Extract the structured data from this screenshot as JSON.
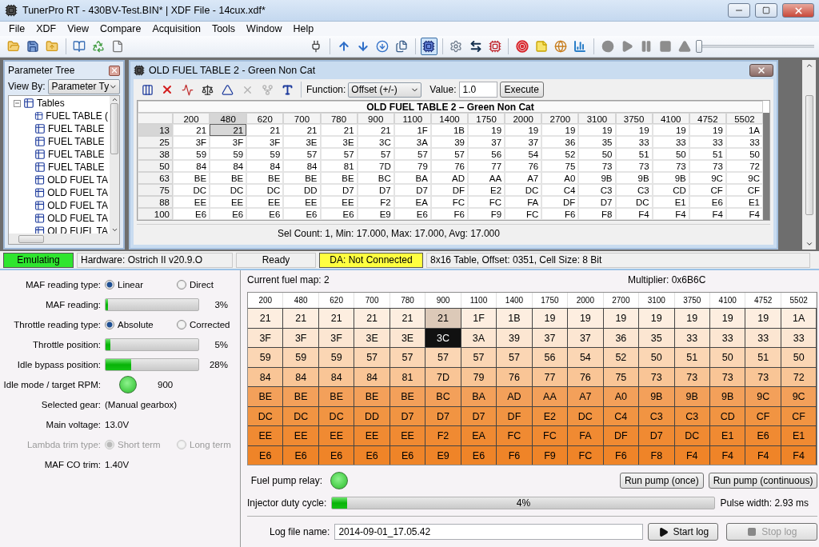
{
  "window": {
    "title": "TunerPro RT - 430BV-Test.BIN* | XDF File - 14cux.xdf*"
  },
  "menu": [
    "File",
    "XDF",
    "View",
    "Compare",
    "Acquisition",
    "Tools",
    "Window",
    "Help"
  ],
  "toolbar": {
    "record_button_disabled": true,
    "position_slider": {
      "level": 0.0
    }
  },
  "parameter_tree": {
    "title": "Parameter Tree",
    "view_by_label": "View By:",
    "view_by_value": "Parameter Ty",
    "items": [
      {
        "label": "Tables",
        "expanded": true,
        "children": [
          {
            "label": "FUEL TABLE ("
          },
          {
            "label": "FUEL TABLE"
          },
          {
            "label": "FUEL TABLE"
          },
          {
            "label": "FUEL TABLE"
          },
          {
            "label": "FUEL TABLE"
          },
          {
            "label": "OLD FUEL TA"
          },
          {
            "label": "OLD FUEL TA"
          },
          {
            "label": "OLD FUEL TA"
          },
          {
            "label": "OLD FUEL TA"
          },
          {
            "label": "OLD FUEL TA"
          }
        ]
      }
    ]
  },
  "table_window": {
    "title": "OLD FUEL TABLE 2 - Green Non Cat",
    "function_label": "Function:",
    "function_value": "Offset (+/-)",
    "value_label": "Value:",
    "value": "1.0",
    "execute": "Execute",
    "table_title": "OLD FUEL TABLE 2 – Green Non Cat",
    "columns": [
      {
        "label": "200",
        "selected": false
      },
      {
        "label": "480",
        "selected": true
      },
      {
        "label": "620",
        "selected": false
      },
      {
        "label": "700",
        "selected": false
      },
      {
        "label": "780",
        "selected": false
      },
      {
        "label": "900",
        "selected": false
      },
      {
        "label": "1100",
        "selected": false
      },
      {
        "label": "1400",
        "selected": false
      },
      {
        "label": "1750",
        "selected": false
      },
      {
        "label": "2000",
        "selected": false
      },
      {
        "label": "2700",
        "selected": false
      },
      {
        "label": "3100",
        "selected": false
      },
      {
        "label": "3750",
        "selected": false
      },
      {
        "label": "4100",
        "selected": false
      },
      {
        "label": "4752",
        "selected": false
      },
      {
        "label": "5502",
        "selected": false
      }
    ],
    "rows": [
      {
        "label": "13",
        "selected": true,
        "cells": [
          "21",
          "21",
          "21",
          "21",
          "21",
          "21",
          "1F",
          "1B",
          "19",
          "19",
          "19",
          "19",
          "19",
          "19",
          "19",
          "1A"
        ]
      },
      {
        "label": "25",
        "selected": false,
        "cells": [
          "3F",
          "3F",
          "3F",
          "3E",
          "3E",
          "3C",
          "3A",
          "39",
          "37",
          "37",
          "36",
          "35",
          "33",
          "33",
          "33",
          "33"
        ]
      },
      {
        "label": "38",
        "selected": false,
        "cells": [
          "59",
          "59",
          "59",
          "57",
          "57",
          "57",
          "57",
          "57",
          "56",
          "54",
          "52",
          "50",
          "51",
          "50",
          "51",
          "50"
        ]
      },
      {
        "label": "50",
        "selected": false,
        "cells": [
          "84",
          "84",
          "84",
          "84",
          "81",
          "7D",
          "79",
          "76",
          "77",
          "76",
          "75",
          "73",
          "73",
          "73",
          "73",
          "72"
        ]
      },
      {
        "label": "63",
        "selected": false,
        "cells": [
          "BE",
          "BE",
          "BE",
          "BE",
          "BE",
          "BC",
          "BA",
          "AD",
          "AA",
          "A7",
          "A0",
          "9B",
          "9B",
          "9B",
          "9C",
          "9C"
        ]
      },
      {
        "label": "75",
        "selected": false,
        "cells": [
          "DC",
          "DC",
          "DC",
          "DD",
          "D7",
          "D7",
          "D7",
          "DF",
          "E2",
          "DC",
          "C4",
          "C3",
          "C3",
          "CD",
          "CF",
          "CF"
        ]
      },
      {
        "label": "88",
        "selected": false,
        "cells": [
          "EE",
          "EE",
          "EE",
          "EE",
          "EE",
          "F2",
          "EA",
          "FC",
          "FC",
          "FA",
          "DF",
          "D7",
          "DC",
          "E1",
          "E6",
          "E1"
        ]
      },
      {
        "label": "100",
        "selected": false,
        "cells": [
          "E6",
          "E6",
          "E6",
          "E6",
          "E6",
          "E9",
          "E6",
          "F6",
          "F9",
          "FC",
          "F6",
          "F8",
          "F4",
          "F4",
          "F4",
          "F4"
        ]
      }
    ],
    "status": "Sel Count: 1, Min: 17.000, Max: 17.000, Avg: 17.000"
  },
  "status_bar": {
    "emulating": "Emulating",
    "hardware": "Hardware: Ostrich II v20.9.O",
    "state": "Ready",
    "da": "DA: Not Connected",
    "info": "8x16 Table, Offset: 0351,  Cell Size: 8 Bit"
  },
  "monitor": [
    {
      "kind": "radio",
      "label": "MAF reading type:",
      "disabled": false,
      "options": [
        {
          "label": "Linear",
          "selected": true
        },
        {
          "label": "Direct",
          "selected": false
        }
      ]
    },
    {
      "kind": "bar",
      "label": "MAF reading:",
      "level": 0.03,
      "reading": "3%"
    },
    {
      "kind": "radio",
      "label": "Throttle reading type:",
      "disabled": false,
      "options": [
        {
          "label": "Absolute",
          "selected": true
        },
        {
          "label": "Corrected",
          "selected": false
        }
      ]
    },
    {
      "kind": "bar",
      "label": "Throttle position:",
      "level": 0.05,
      "reading": "5%"
    },
    {
      "kind": "bar",
      "label": "Idle bypass position:",
      "level": 0.28,
      "reading": "28%"
    },
    {
      "kind": "led",
      "label": "Idle mode / target RPM:",
      "on": true,
      "reading": "900"
    },
    {
      "kind": "text",
      "label": "Selected gear:",
      "value": "(Manual gearbox)"
    },
    {
      "kind": "text",
      "label": "Main voltage:",
      "value": "13.0V"
    },
    {
      "kind": "radio",
      "label": "Lambda trim type:",
      "disabled": true,
      "options": [
        {
          "label": "Short term",
          "selected": true
        },
        {
          "label": "Long term",
          "selected": false
        }
      ]
    },
    {
      "kind": "text",
      "label": "MAF CO trim:",
      "value": "1.40V"
    }
  ],
  "fuel_map": {
    "current": "Current fuel map: 2",
    "multiplier": "Multiplier: 0x6B6C",
    "columns": [
      {
        "label": "200",
        "selected": false
      },
      {
        "label": "480",
        "selected": false
      },
      {
        "label": "620",
        "selected": false
      },
      {
        "label": "700",
        "selected": false
      },
      {
        "label": "780",
        "selected": false
      },
      {
        "label": "900",
        "selected": true
      },
      {
        "label": "1100",
        "selected": false
      },
      {
        "label": "1400",
        "selected": false
      },
      {
        "label": "1750",
        "selected": false
      },
      {
        "label": "2000",
        "selected": false
      },
      {
        "label": "2700",
        "selected": false
      },
      {
        "label": "3100",
        "selected": false
      },
      {
        "label": "3750",
        "selected": false
      },
      {
        "label": "4100",
        "selected": false
      },
      {
        "label": "4752",
        "selected": false
      },
      {
        "label": "5502",
        "selected": false
      }
    ],
    "rows": [
      {
        "color": "#fdeee0",
        "visited": true,
        "current": false,
        "cells": [
          "21",
          "21",
          "21",
          "21",
          "21",
          "21",
          "1F",
          "1B",
          "19",
          "19",
          "19",
          "19",
          "19",
          "19",
          "19",
          "1A"
        ]
      },
      {
        "color": "#fce6d2",
        "visited": false,
        "current": true,
        "cells": [
          "3F",
          "3F",
          "3F",
          "3E",
          "3E",
          "3C",
          "3A",
          "39",
          "37",
          "37",
          "36",
          "35",
          "33",
          "33",
          "33",
          "33"
        ]
      },
      {
        "color": "#fbd6b4",
        "visited": false,
        "current": false,
        "cells": [
          "59",
          "59",
          "59",
          "57",
          "57",
          "57",
          "57",
          "57",
          "56",
          "54",
          "52",
          "50",
          "51",
          "50",
          "51",
          "50"
        ]
      },
      {
        "color": "#f9c596",
        "visited": false,
        "current": false,
        "cells": [
          "84",
          "84",
          "84",
          "84",
          "81",
          "7D",
          "79",
          "76",
          "77",
          "76",
          "75",
          "73",
          "73",
          "73",
          "73",
          "72"
        ]
      },
      {
        "color": "#f3a05a",
        "visited": false,
        "current": false,
        "cells": [
          "BE",
          "BE",
          "BE",
          "BE",
          "BE",
          "BC",
          "BA",
          "AD",
          "AA",
          "A7",
          "A0",
          "9B",
          "9B",
          "9B",
          "9C",
          "9C"
        ]
      },
      {
        "color": "#f19442",
        "visited": false,
        "current": false,
        "cells": [
          "DC",
          "DC",
          "DC",
          "DD",
          "D7",
          "D7",
          "D7",
          "DF",
          "E2",
          "DC",
          "C4",
          "C3",
          "C3",
          "CD",
          "CF",
          "CF"
        ]
      },
      {
        "color": "#f08a32",
        "visited": false,
        "current": false,
        "cells": [
          "EE",
          "EE",
          "EE",
          "EE",
          "EE",
          "F2",
          "EA",
          "FC",
          "FC",
          "FA",
          "DF",
          "D7",
          "DC",
          "E1",
          "E6",
          "E1"
        ]
      },
      {
        "color": "#ef8428",
        "visited": false,
        "current": false,
        "cells": [
          "E6",
          "E6",
          "E6",
          "E6",
          "E6",
          "E9",
          "E6",
          "F6",
          "F9",
          "FC",
          "F6",
          "F8",
          "F4",
          "F4",
          "F4",
          "F4"
        ]
      }
    ]
  },
  "pump": {
    "label": "Fuel pump relay:",
    "on": true,
    "run_once": "Run pump (once)",
    "run_continuous": "Run pump (continuous)"
  },
  "injector": {
    "label": "Injector duty cycle:",
    "level": 0.04,
    "reading": "4%",
    "pulse": "Pulse width: 2.93 ms"
  },
  "log": {
    "label": "Log file name:",
    "value": "2014-09-01_17.05.42",
    "start": "Start log",
    "stop": "Stop log",
    "stop_disabled": true
  }
}
